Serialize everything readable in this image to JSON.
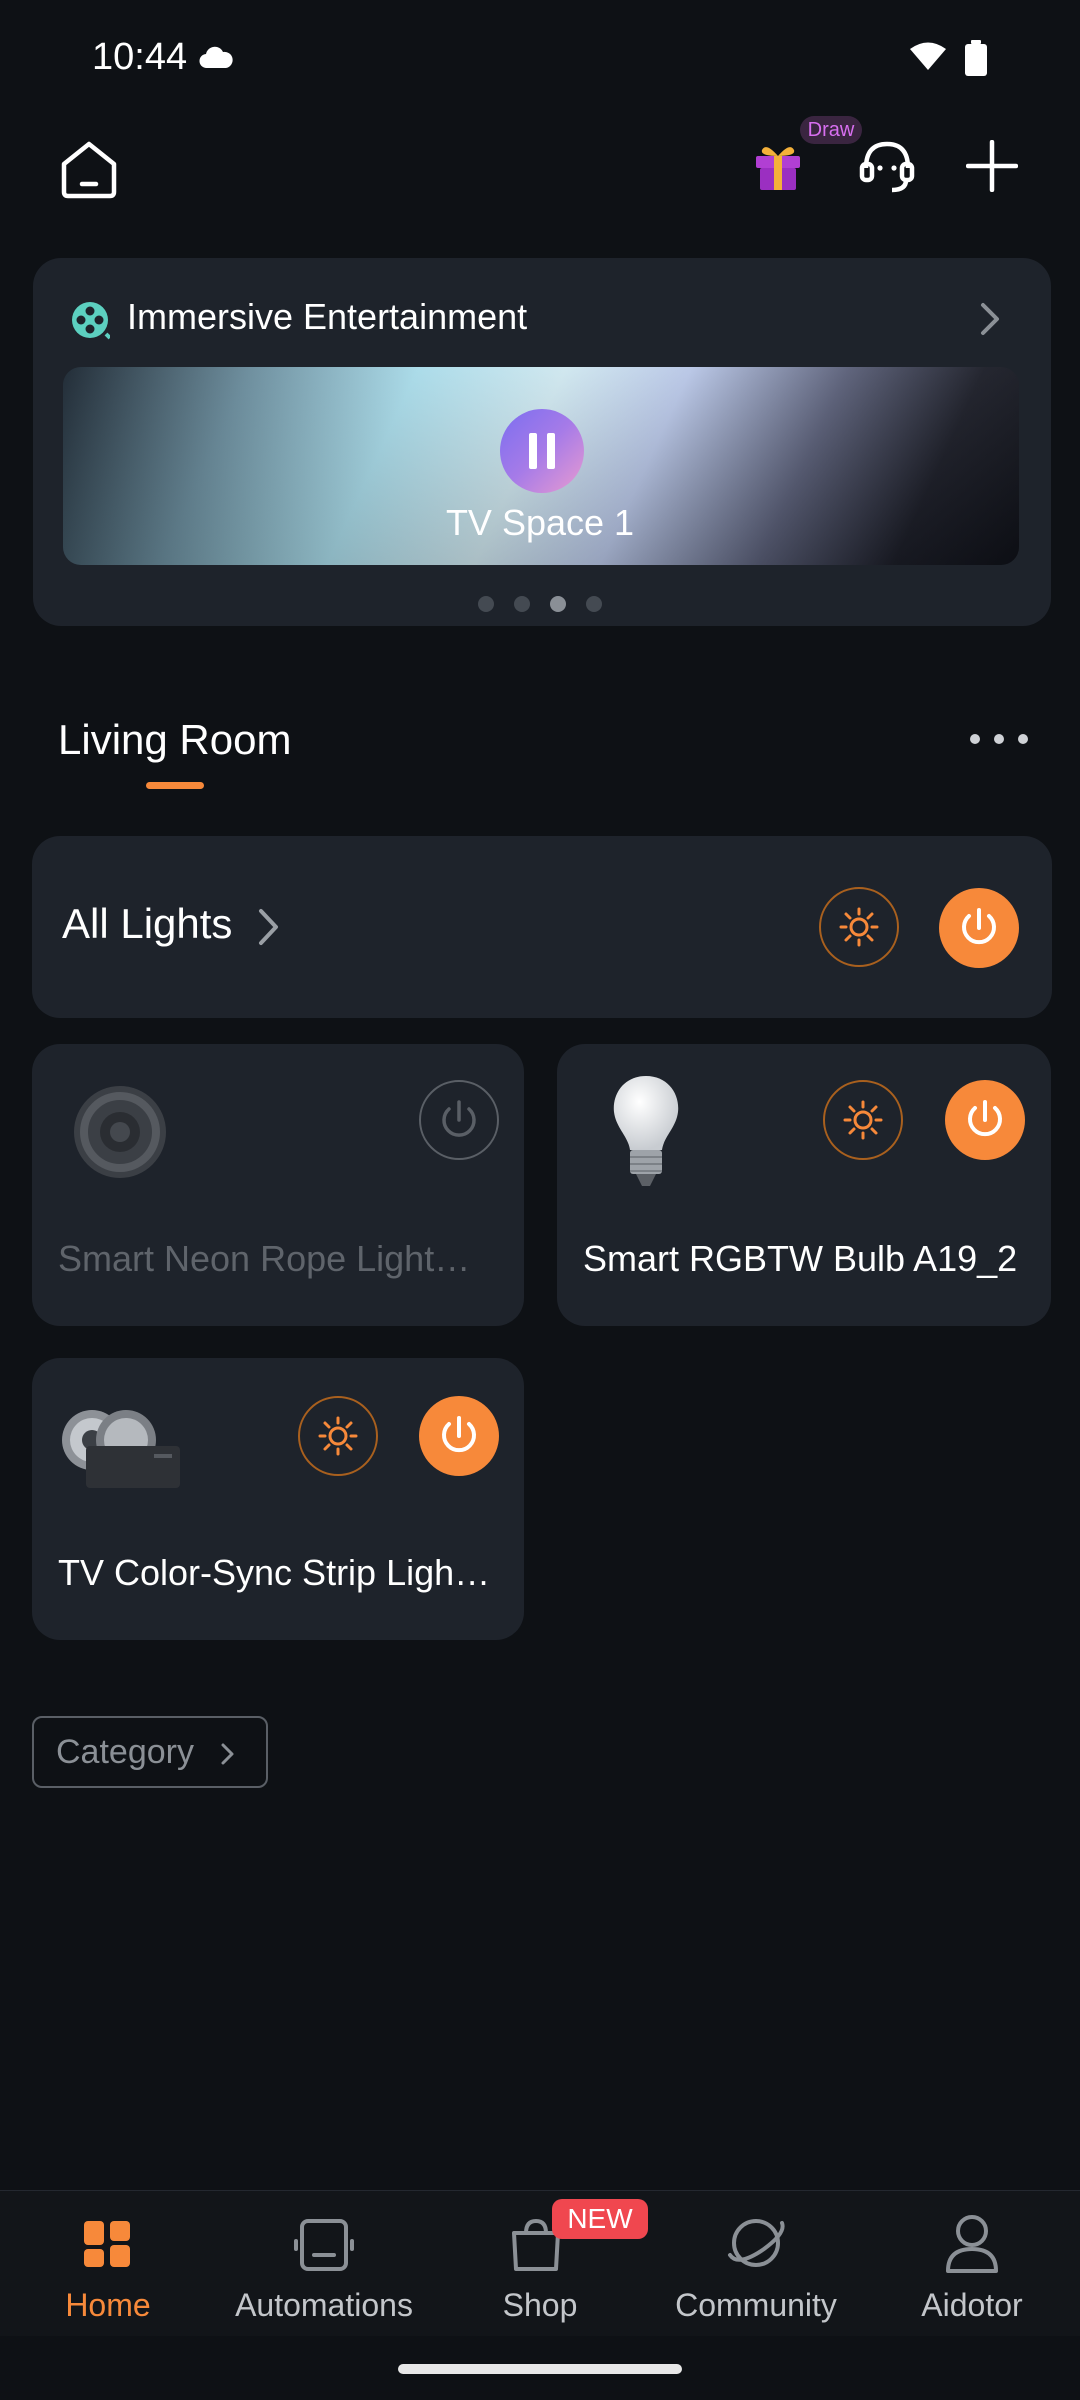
{
  "status_bar": {
    "time": "10:44"
  },
  "top_bar": {
    "draw_badge": "Draw"
  },
  "immersive": {
    "title": "Immersive Entertainment",
    "current_scene": "TV Space 1",
    "pages": 4,
    "active_page": 3
  },
  "room": {
    "name": "Living Room"
  },
  "all_lights": {
    "label": "All Lights",
    "power": "on"
  },
  "devices": [
    {
      "name": "Smart Neon Rope Light…",
      "power": "off"
    },
    {
      "name": "Smart RGBTW Bulb A19_2",
      "power": "on"
    },
    {
      "name": "TV Color-Sync Strip Ligh…",
      "power": "on"
    }
  ],
  "category_label": "Category",
  "bottom_nav": {
    "items": [
      {
        "label": "Home",
        "icon": "home-grid-icon",
        "active": true
      },
      {
        "label": "Automations",
        "icon": "automation-icon"
      },
      {
        "label": "Shop",
        "icon": "shopping-bag-icon",
        "badge": "NEW"
      },
      {
        "label": "Community",
        "icon": "planet-icon"
      },
      {
        "label": "Aidotor",
        "icon": "profile-icon"
      }
    ]
  },
  "colors": {
    "background": "#0e1115",
    "card": "#1e232b",
    "accent": "#f7893a",
    "badge_red": "#f0474f"
  }
}
